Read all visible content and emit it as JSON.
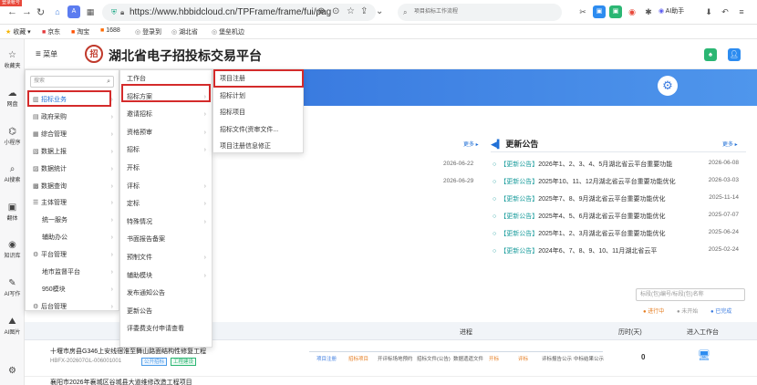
{
  "badge": "登录帐号",
  "browser": {
    "url": "https://www.hbbidcloud.cn/TPFrame/frame/fui/pag",
    "search_placeholder": "项目招标工作流程",
    "ai_label": "AI助手",
    "bookmarks": [
      "收藏",
      "京东",
      "淘宝",
      "1688",
      "登录到",
      "湖北省",
      "堡垒机边"
    ]
  },
  "leftrail": [
    {
      "icon": "☆",
      "label": "收藏夹"
    },
    {
      "icon": "☁",
      "label": "网盘"
    },
    {
      "icon": "⌬",
      "label": "小程序"
    },
    {
      "icon": "⌕",
      "label": "AI搜索"
    },
    {
      "icon": "▣",
      "label": "翻体"
    },
    {
      "icon": "◉",
      "label": "知识库"
    },
    {
      "icon": "✎",
      "label": "AI写作"
    },
    {
      "icon": "⛰",
      "label": "AI图片"
    },
    {
      "icon": "⚙",
      "label": ""
    }
  ],
  "app": {
    "menu_label": "菜单",
    "logo_text": "招",
    "title": "湖北省电子招投标交易平台"
  },
  "sections": {
    "left_more": "更多 ▸",
    "notice_title": "更新公告",
    "notice_more": "更多 ▸",
    "left_dates": [
      "2026-06-22",
      "2026-06-29"
    ]
  },
  "notices": [
    {
      "tag": "【更新公告】",
      "text": "2026年1、2、3、4、5月湖北省云平台重要功能",
      "date": "2026-06-08"
    },
    {
      "tag": "【更新公告】",
      "text": "2025年10、11、12月湖北省云平台重要功能优化",
      "date": "2026-03-03"
    },
    {
      "tag": "【更新公告】",
      "text": "2025年7、8、9月湖北省云平台重要功能优化",
      "date": "2025-11-14"
    },
    {
      "tag": "【更新公告】",
      "text": "2025年4、5、6月湖北省云平台重要功能优化",
      "date": "2025-07-07"
    },
    {
      "tag": "【更新公告】",
      "text": "2025年1、2、3月湖北省云平台重要功能优化",
      "date": "2025-06-24"
    },
    {
      "tag": "【更新公告】",
      "text": "2024年6、7、8、9、10、11月湖北省云平",
      "date": "2025-02-24"
    }
  ],
  "filter": {
    "placeholder": "标段(包)编号/标段(包)名称",
    "legend": [
      "● 进行中",
      "● 未开始",
      "● 已完成"
    ]
  },
  "table": {
    "headers": [
      "进程",
      "历时(天)",
      "进入工作台"
    ],
    "row1": {
      "name": "十堰市房县G346上安线宿淮至舞山路面结构性修复工程",
      "code": "HBFX-202607GL-006001001",
      "chips": [
        "公开招标",
        "工程建设"
      ],
      "steps": [
        "项目注册",
        "招标项目",
        "开评标场地预约",
        "招标文件(公告)",
        "数据遗遗文件",
        "开标",
        "评标",
        "评标报告公示",
        "中标结果公示"
      ],
      "days": "0"
    },
    "row2_name": "襄阳市2026年襄城区谷城县大道维修改造工程项目"
  },
  "menu1": {
    "search_placeholder": "搜索",
    "items": [
      {
        "label": "招标业务",
        "icon": "▥",
        "arrow": true,
        "sub": false
      },
      {
        "label": "政府采购",
        "icon": "▤",
        "arrow": true,
        "sub": false
      },
      {
        "label": "综合管理",
        "icon": "▦",
        "arrow": true,
        "sub": false
      },
      {
        "label": "数据上报",
        "icon": "▧",
        "arrow": true,
        "sub": false
      },
      {
        "label": "数据统计",
        "icon": "▨",
        "arrow": true,
        "sub": false
      },
      {
        "label": "数据查询",
        "icon": "▩",
        "arrow": true,
        "sub": false
      },
      {
        "label": "主体管理",
        "icon": "☰",
        "arrow": true,
        "sub": false
      },
      {
        "label": "统一服务",
        "icon": "",
        "arrow": true,
        "sub": true
      },
      {
        "label": "辅助办公",
        "icon": "",
        "arrow": true,
        "sub": true
      },
      {
        "label": "平台管理",
        "icon": "⚙",
        "arrow": true,
        "sub": false
      },
      {
        "label": "地市监督平台",
        "icon": "",
        "arrow": true,
        "sub": true
      },
      {
        "label": "950模块",
        "icon": "",
        "arrow": true,
        "sub": true
      },
      {
        "label": "后台管理",
        "icon": "⚙",
        "arrow": true,
        "sub": false
      }
    ]
  },
  "menu2": {
    "items": [
      {
        "label": "工作台",
        "arrow": false
      },
      {
        "label": "招标方案",
        "arrow": true
      },
      {
        "label": "邀请招标",
        "arrow": true
      },
      {
        "label": "资格预审",
        "arrow": true
      },
      {
        "label": "招标",
        "arrow": true
      },
      {
        "label": "开标",
        "arrow": false
      },
      {
        "label": "评标",
        "arrow": true
      },
      {
        "label": "定标",
        "arrow": true
      },
      {
        "label": "特殊情况",
        "arrow": true
      },
      {
        "label": "书面报告备案",
        "arrow": false
      },
      {
        "label": "预制文件",
        "arrow": true
      },
      {
        "label": "辅助模块",
        "arrow": true
      },
      {
        "label": "发布通知公告",
        "arrow": false
      },
      {
        "label": "更新公告",
        "arrow": false
      },
      {
        "label": "评委费支付申请查看",
        "arrow": false
      }
    ]
  },
  "menu3": {
    "items": [
      "项目注册",
      "招标计划",
      "招标项目",
      "招标文件(资审文件...",
      "项目注册信息修正"
    ]
  }
}
